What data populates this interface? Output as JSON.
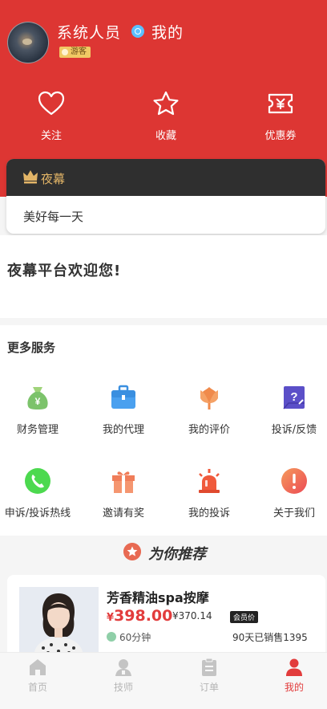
{
  "profile": {
    "name": "系统人员",
    "mine": "我的",
    "badge": "游客"
  },
  "quick_actions": [
    {
      "label": "关注",
      "icon": "heart-icon"
    },
    {
      "label": "收藏",
      "icon": "star-icon"
    },
    {
      "label": "优惠券",
      "icon": "coupon-icon"
    }
  ],
  "vip_card": {
    "title": "夜幕",
    "text": "美好每一天"
  },
  "welcome": "夜幕平台欢迎您!",
  "services": {
    "title": "更多服务",
    "items": [
      {
        "label": "财务管理",
        "icon": "money-bag-icon"
      },
      {
        "label": "我的代理",
        "icon": "briefcase-icon"
      },
      {
        "label": "我的评价",
        "icon": "flower-icon"
      },
      {
        "label": "投诉/反馈",
        "icon": "feedback-icon"
      },
      {
        "label": "申诉/投诉热线",
        "icon": "phone-icon"
      },
      {
        "label": "邀请有奖",
        "icon": "gift-icon"
      },
      {
        "label": "我的投诉",
        "icon": "alarm-icon"
      },
      {
        "label": "关于我们",
        "icon": "info-icon"
      }
    ]
  },
  "recommend": {
    "title": "为你推荐",
    "product": {
      "title": "芳香精油spa按摩",
      "currency": "¥",
      "price": "398.00",
      "old_price": "¥370.14",
      "member_badge": "会员价",
      "duration": "60分钟",
      "sales": "90天已销售1395"
    }
  },
  "tabs": [
    {
      "label": "首页",
      "icon": "home-icon",
      "active": false
    },
    {
      "label": "技师",
      "icon": "technician-icon",
      "active": false
    },
    {
      "label": "订单",
      "icon": "order-icon",
      "active": false
    },
    {
      "label": "我的",
      "icon": "user-icon",
      "active": true
    }
  ],
  "colors": {
    "header_red": "#dd3633",
    "accent_red": "#e23c3c",
    "gold": "#e3b567",
    "dark_card": "#2f2f2f"
  }
}
